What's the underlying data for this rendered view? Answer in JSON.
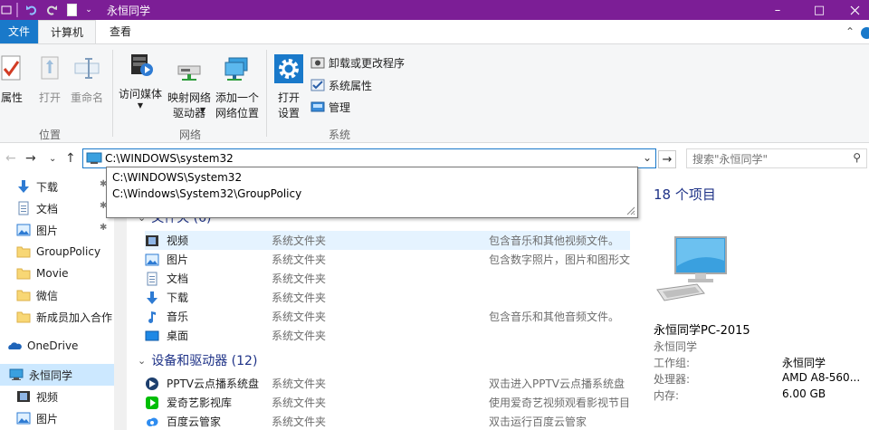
{
  "titlebar": {
    "title": "永恒同学",
    "bg_color": "#7c1e96",
    "minimize": "–",
    "maximize": "□"
  },
  "ribbon_tabs": {
    "file": "文件",
    "computer": "计算机",
    "view": "查看"
  },
  "ribbon": {
    "location_group": {
      "label": "位置",
      "properties": "属性",
      "open": "打开",
      "rename": "重命名"
    },
    "network_group": {
      "label": "网络",
      "access_media": "访问媒体",
      "map_drive_line1": "映射网络",
      "map_drive_line2": "驱动器",
      "add_location_line1": "添加一个",
      "add_location_line2": "网络位置"
    },
    "system_group": {
      "label": "系统",
      "open_settings_line1": "打开",
      "open_settings_line2": "设置",
      "uninstall": "卸载或更改程序",
      "system_properties": "系统属性",
      "manage": "管理"
    }
  },
  "address": {
    "value": "C:\\WINDOWS\\system32",
    "suggestions": [
      "C:\\WINDOWS\\System32",
      "C:\\Windows\\System32\\GroupPolicy"
    ]
  },
  "search": {
    "placeholder": "搜索\"永恒同学\""
  },
  "sidebar": {
    "items": [
      {
        "label": "下载",
        "icon": "download-icon",
        "pinned": true
      },
      {
        "label": "文档",
        "icon": "document-icon",
        "pinned": true
      },
      {
        "label": "图片",
        "icon": "pictures-icon",
        "pinned": true
      },
      {
        "label": "GroupPolicy",
        "icon": "folder-icon"
      },
      {
        "label": "Movie",
        "icon": "folder-icon"
      },
      {
        "label": "微信",
        "icon": "folder-icon"
      },
      {
        "label": "新成员加入合作",
        "icon": "folder-icon"
      },
      {
        "label": "OneDrive",
        "icon": "onedrive-icon"
      },
      {
        "label": "永恒同学",
        "icon": "pc-icon",
        "selected": true
      },
      {
        "label": "视频",
        "icon": "videos-icon"
      },
      {
        "label": "图片",
        "icon": "pictures-icon"
      }
    ]
  },
  "main": {
    "folders_header": "文件夹 (6)",
    "devices_header": "设备和驱动器 (12)",
    "folders": [
      {
        "name": "视频",
        "type": "系统文件夹",
        "desc": "包含音乐和其他视频文件。",
        "icon": "videos-icon"
      },
      {
        "name": "图片",
        "type": "系统文件夹",
        "desc": "包含数字照片，图片和图形文",
        "icon": "pictures-icon"
      },
      {
        "name": "文档",
        "type": "系统文件夹",
        "desc": "",
        "icon": "document-icon"
      },
      {
        "name": "下载",
        "type": "系统文件夹",
        "desc": "",
        "icon": "download-icon"
      },
      {
        "name": "音乐",
        "type": "系统文件夹",
        "desc": "包含音乐和其他音频文件。",
        "icon": "music-icon"
      },
      {
        "name": "桌面",
        "type": "系统文件夹",
        "desc": "",
        "icon": "desktop-icon"
      }
    ],
    "devices": [
      {
        "name": "PPTV云点播系统盘",
        "type": "系统文件夹",
        "desc": "双击进入PPTV云点播系统盘",
        "icon": "pptv-icon"
      },
      {
        "name": "爱奇艺影视库",
        "type": "系统文件夹",
        "desc": "使用爱奇艺视频观看影视节目",
        "icon": "iqiyi-icon"
      },
      {
        "name": "百度云管家",
        "type": "系统文件夹",
        "desc": "双击运行百度云管家",
        "icon": "baidu-cloud-icon"
      }
    ]
  },
  "details": {
    "count": "18 个项目",
    "pc_name": "永恒同学PC-2015",
    "pc_group": "永恒同学",
    "workgroup_label": "工作组:",
    "workgroup_value": "永恒同学",
    "cpu_label": "处理器:",
    "cpu_value": "AMD A8-560...",
    "memory_label": "内存:",
    "memory_value": "6.00 GB"
  }
}
